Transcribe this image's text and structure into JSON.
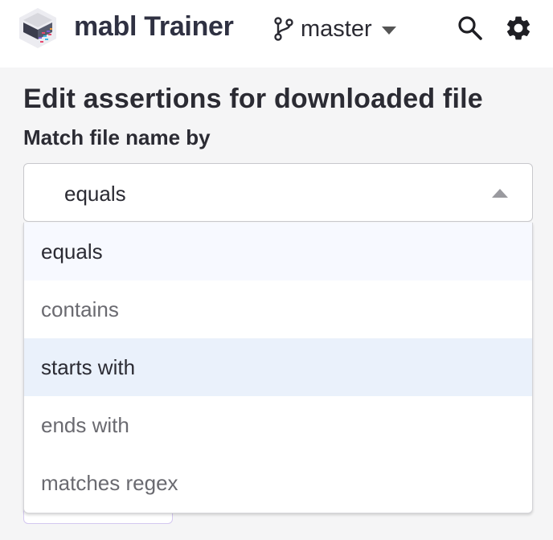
{
  "app": {
    "title": "mabl Trainer"
  },
  "branch": {
    "label": "master",
    "icon": "git-branch-icon"
  },
  "toolbar": {
    "search_icon": "search-icon",
    "settings_icon": "gear-icon"
  },
  "page": {
    "heading": "Edit assertions for downloaded file",
    "field_label": "Match file name by"
  },
  "select": {
    "value": "equals",
    "options": [
      "equals",
      "contains",
      "starts with",
      "ends with",
      "matches regex"
    ],
    "selected_index": 0,
    "hovered_index": 2
  },
  "colors": {
    "accent_purple": "#7b5cd6",
    "selected_bg": "#f7f9ff",
    "hover_bg": "#eaf1fb"
  }
}
